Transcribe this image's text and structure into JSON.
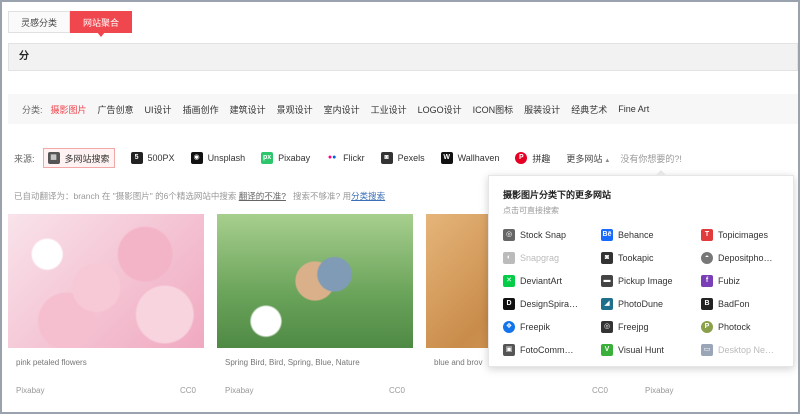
{
  "top_tabs": [
    "灵感分类",
    "网站聚合"
  ],
  "search": {
    "value": "分"
  },
  "categories": {
    "label": "分类:",
    "items": [
      "摄影图片",
      "广告创意",
      "UI设计",
      "插画创作",
      "建筑设计",
      "景观设计",
      "室内设计",
      "工业设计",
      "LOGO设计",
      "ICON图标",
      "服装设计",
      "经典艺术",
      "Fine Art"
    ]
  },
  "sources": {
    "label": "来源:",
    "items": [
      {
        "label": "多网站搜索",
        "icon": "multi-site-icon",
        "color": "#555555"
      },
      {
        "label": "500PX",
        "icon": "500px-icon",
        "color": "#222222"
      },
      {
        "label": "Unsplash",
        "icon": "camera-icon",
        "color": "#111111"
      },
      {
        "label": "Pixabay",
        "icon": "pixabay-icon",
        "color": "#2ec66d"
      },
      {
        "label": "Flickr",
        "icon": "flickr-icon",
        "color": "#ff0084"
      },
      {
        "label": "Pexels",
        "icon": "pexels-icon",
        "color": "#333333"
      },
      {
        "label": "Wallhaven",
        "icon": "wallhaven-icon",
        "color": "#111111"
      },
      {
        "label": "拼趣",
        "icon": "pinterest-icon",
        "color": "#e60023"
      }
    ],
    "more": "更多网站",
    "hint": "没有你想要的?!"
  },
  "notice": {
    "text": "已自动翻译为：branch 在 \"摄影图片\" 的6个精选网站中搜索",
    "link1": "翻译的不准?",
    "text2": "搜索不够准? 用",
    "link2": "分类搜索"
  },
  "cards": [
    {
      "title": "pink petaled flowers",
      "source": "Pixabay",
      "license": "CC0"
    },
    {
      "title": "Spring Bird, Bird, Spring, Blue, Nature",
      "source": "Pixabay",
      "license": "CC0"
    },
    {
      "title": "blue and brov",
      "source": "",
      "license": ""
    },
    {
      "title": "",
      "source": "",
      "license": "CC0"
    },
    {
      "title": "",
      "source": "Pixabay",
      "license": ""
    }
  ],
  "more_sites": {
    "title": "摄影图片分类下的更多网站",
    "subtitle": "点击可直接搜索",
    "items": [
      {
        "label": "Stock Snap",
        "icon": "stocksnap-icon",
        "color": "#666666",
        "dim": false
      },
      {
        "label": "Behance",
        "icon": "behance-icon",
        "color": "#1769ff",
        "dim": false
      },
      {
        "label": "Topicimages",
        "icon": "topicimages-icon",
        "color": "#e23b3b",
        "dim": false
      },
      {
        "label": "Snapgrag",
        "icon": "snapgrag-icon",
        "color": "#bbbbbb",
        "dim": true
      },
      {
        "label": "Tookapic",
        "icon": "tookapic-icon",
        "color": "#333333",
        "dim": false
      },
      {
        "label": "Depositpho…",
        "icon": "depositphotos-icon",
        "color": "#777777",
        "dim": false
      },
      {
        "label": "DeviantArt",
        "icon": "deviantart-icon",
        "color": "#05cc47",
        "dim": false
      },
      {
        "label": "Pickup Image",
        "icon": "pickup-image-icon",
        "color": "#444444",
        "dim": false
      },
      {
        "label": "Fubiz",
        "icon": "fubiz-icon",
        "color": "#7a3fb6",
        "dim": false
      },
      {
        "label": "DesignSpira…",
        "icon": "designspiration-icon",
        "color": "#111111",
        "dim": false
      },
      {
        "label": "PhotoDune",
        "icon": "photodune-icon",
        "color": "#1f6e8c",
        "dim": false
      },
      {
        "label": "BadFon",
        "icon": "badfon-icon",
        "color": "#222222",
        "dim": false
      },
      {
        "label": "Freepik",
        "icon": "freepik-icon",
        "color": "#1273eb",
        "dim": false
      },
      {
        "label": "Freejpg",
        "icon": "freejpg-icon",
        "color": "#333333",
        "dim": false
      },
      {
        "label": "Photock",
        "icon": "photock-icon",
        "color": "#8aa04a",
        "dim": false
      },
      {
        "label": "FotoComm…",
        "icon": "fotocommunity-icon",
        "color": "#555555",
        "dim": false
      },
      {
        "label": "Visual Hunt",
        "icon": "visual-hunt-icon",
        "color": "#3ab03a",
        "dim": false
      },
      {
        "label": "Desktop Ne…",
        "icon": "desktop-nexus-icon",
        "color": "#9aa6b8",
        "dim": true
      }
    ]
  }
}
